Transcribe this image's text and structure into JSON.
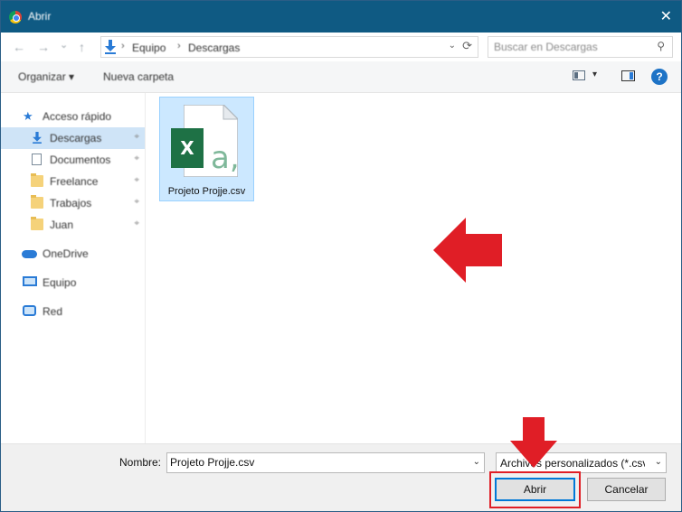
{
  "window": {
    "title": "Abrir",
    "close_glyph": "✕"
  },
  "nav_buttons": {
    "back": "←",
    "forward": "→",
    "recent": "⌄",
    "up": "↑"
  },
  "address": {
    "crumbs": [
      "Equipo",
      "Descargas"
    ],
    "separator": "›",
    "dropdown": "⌄",
    "refresh": "⟳"
  },
  "search": {
    "placeholder": "Buscar en Descargas",
    "icon": "search-icon"
  },
  "toolbar": {
    "organize_label": "Organizar ▾",
    "new_folder_label": "Nueva carpeta",
    "help_label": "?"
  },
  "sidebar": {
    "items": [
      {
        "label": "Acceso rápido",
        "icon": "star-icon",
        "pinned": false
      },
      {
        "label": "Descargas",
        "icon": "download-icon",
        "pinned": true,
        "selected": true
      },
      {
        "label": "Documentos",
        "icon": "document-icon",
        "pinned": true
      },
      {
        "label": "Freelance",
        "icon": "folder-icon",
        "pinned": true
      },
      {
        "label": "Trabajos",
        "icon": "folder-icon",
        "pinned": true
      },
      {
        "label": "Juan",
        "icon": "folder-icon",
        "pinned": true
      },
      {
        "label": "OneDrive",
        "icon": "cloud-icon",
        "pinned": false
      },
      {
        "label": "Equipo",
        "icon": "computer-icon",
        "pinned": false
      },
      {
        "label": "Red",
        "icon": "network-icon",
        "pinned": false
      }
    ],
    "pin_glyph": "⌖"
  },
  "files": [
    {
      "name": "Projeto Projje.csv",
      "icon": "excel-csv-icon",
      "badge_letter": "X",
      "overlay_letter": "a,",
      "selected": true
    }
  ],
  "bottom": {
    "name_label": "Nombre:",
    "name_value": "Projeto Projje.csv",
    "type_value": "Archivos personalizados (*.csv;*",
    "dropdown_glyph": "⌄",
    "open_label": "Abrir",
    "cancel_label": "Cancelar"
  },
  "colors": {
    "titlebar": "#0f5a83",
    "selection": "#cce8ff",
    "annotation_red": "#e01e26",
    "excel_green": "#1e7145"
  }
}
